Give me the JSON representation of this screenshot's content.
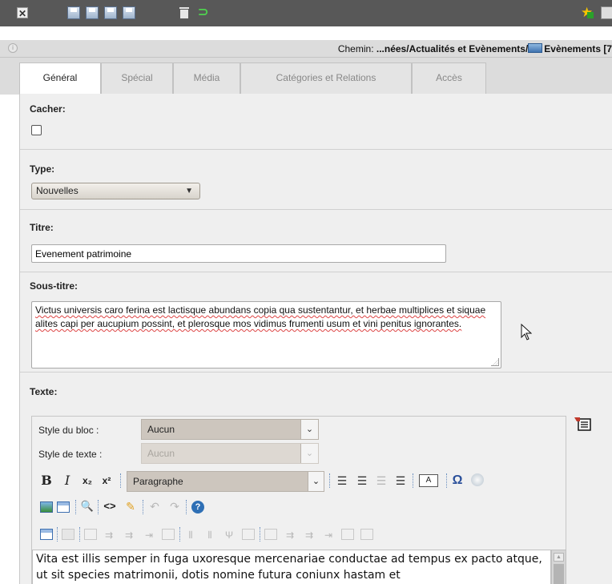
{
  "toolbar": {
    "close_icon": "close-icon",
    "save_icons": [
      "save-icon",
      "save-close-icon",
      "save-view-icon",
      "save-new-icon"
    ],
    "delete_icon": "trash-icon",
    "undo_icon": "undo-icon",
    "favorite_icon": "star-plus-icon",
    "close_glyph": "✕",
    "undo_glyph": "⊃",
    "star_glyph": "★"
  },
  "path": {
    "label": "Chemin:",
    "value": "...nées/Actualités et Evènements/",
    "folder": "Evènements [7"
  },
  "tabs": [
    {
      "label": "Général",
      "active": true
    },
    {
      "label": "Spécial",
      "active": false
    },
    {
      "label": "Média",
      "active": false
    },
    {
      "label": "Catégories et Relations",
      "active": false
    },
    {
      "label": "Accès",
      "active": false
    }
  ],
  "fields": {
    "hide": {
      "label": "Cacher:",
      "checked": false
    },
    "type": {
      "label": "Type:",
      "value": "Nouvelles",
      "arrow": "▼"
    },
    "title": {
      "label": "Titre:",
      "value": "Evenement patrimoine"
    },
    "subtitle": {
      "label": "Sous-titre:",
      "value": "Victus universis caro ferina est lactisque abundans copia qua sustentantur, et herbae multiplices et siquae alites capi per aucupium possint, et plerosque mos vidimus frumenti usum et vini penitus ignorantes."
    },
    "text": {
      "label": "Texte:"
    }
  },
  "editor": {
    "block_style_label": "Style du bloc :",
    "block_style_value": "Aucun",
    "text_style_label": "Style de texte :",
    "text_style_value": "Aucun",
    "bold": "B",
    "italic": "I",
    "subscript": "x₂",
    "superscript": "x²",
    "format_value": "Paragraphe",
    "format_box": "A",
    "special_char": "Ω",
    "code_glyph": "<>",
    "find_glyph": "🔍",
    "help_glyph": "?",
    "chevron": "⌄",
    "content": "Vita est illis semper in fuga uxoresque mercenariae conductae ad tempus ex pacto atque, ut sit species matrimonii, dotis nomine futura coniunx hastam et"
  },
  "colors": {
    "toolbar_bg": "#585858",
    "panel_bg": "#efefef",
    "accent_blue": "#2e6fb5"
  }
}
